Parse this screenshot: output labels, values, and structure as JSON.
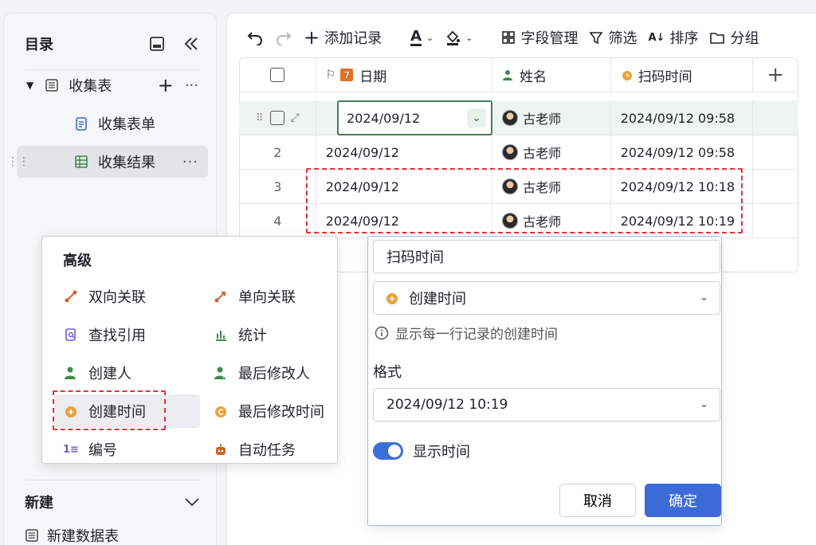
{
  "sidebar": {
    "title": "目录",
    "tree": [
      {
        "label": "收集表",
        "more": "···"
      },
      {
        "label": "收集表单"
      },
      {
        "label": "收集结果",
        "more": "···"
      }
    ],
    "new_section": "新建",
    "new_item": "新建数据表"
  },
  "toolbar": {
    "add_record": "添加记录",
    "font_glyph": "A",
    "field_manage": "字段管理",
    "filter": "筛选",
    "sort": "排序",
    "group": "分组"
  },
  "grid": {
    "headers": [
      "日期",
      "姓名",
      "扫码时间"
    ],
    "rows": [
      {
        "num": "",
        "date": "2024/09/12",
        "name": "古老师",
        "scan": "2024/09/12 09:58"
      },
      {
        "num": "2",
        "date": "2024/09/12",
        "name": "古老师",
        "scan": "2024/09/12 09:58"
      },
      {
        "num": "3",
        "date": "2024/09/12",
        "name": "古老师",
        "scan": "2024/09/12 10:18"
      },
      {
        "num": "4",
        "date": "2024/09/12",
        "name": "古老师",
        "scan": "2024/09/12 10:19"
      }
    ]
  },
  "menu": {
    "title": "高级",
    "items": [
      {
        "label": "双向关联",
        "icon": "link-two-way-icon"
      },
      {
        "label": "单向关联",
        "icon": "link-one-way-icon"
      },
      {
        "label": "查找引用",
        "icon": "lookup-icon"
      },
      {
        "label": "统计",
        "icon": "stats-icon"
      },
      {
        "label": "创建人",
        "icon": "creator-icon"
      },
      {
        "label": "最后修改人",
        "icon": "modifier-icon"
      },
      {
        "label": "创建时间",
        "icon": "created-time-icon"
      },
      {
        "label": "最后修改时间",
        "icon": "modified-time-icon"
      },
      {
        "label": "编号",
        "icon": "numbering-icon"
      },
      {
        "label": "自动任务",
        "icon": "auto-task-icon"
      }
    ]
  },
  "panel": {
    "field_name": "扫码时间",
    "field_type": "创建时间",
    "hint": "显示每一行记录的创建时间",
    "format_label": "格式",
    "format_value": "2024/09/12 10:19",
    "show_time_label": "显示时间",
    "cancel": "取消",
    "ok": "确定"
  },
  "colors": {
    "accent": "#3d6bd6",
    "highlight_dash": "#e0333b",
    "active_cell_border": "#4a7c59",
    "clock_icon": "#e8a33a"
  }
}
